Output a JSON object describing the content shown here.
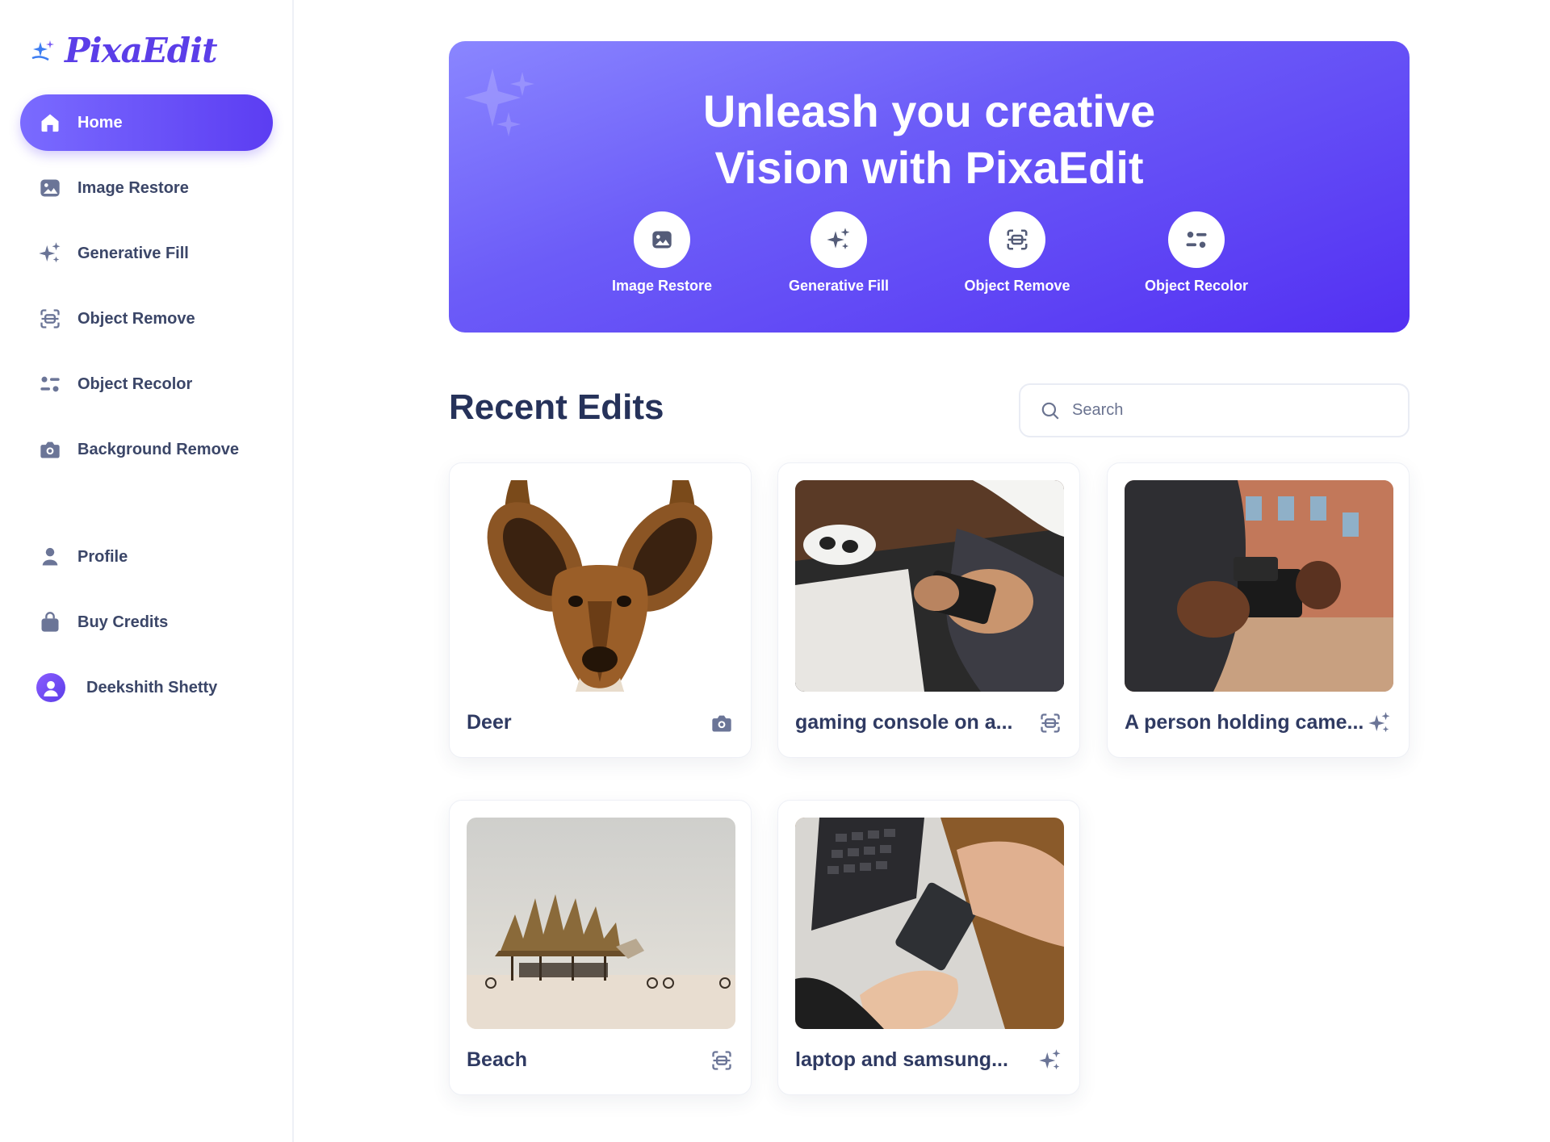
{
  "brand": {
    "name": "PixaEdit"
  },
  "sidebar": {
    "items": [
      {
        "label": "Home",
        "icon": "home-icon",
        "active": true
      },
      {
        "label": "Image Restore",
        "icon": "image-icon"
      },
      {
        "label": "Generative Fill",
        "icon": "sparkles-icon"
      },
      {
        "label": "Object Remove",
        "icon": "scan-icon"
      },
      {
        "label": "Object Recolor",
        "icon": "recolor-icon"
      },
      {
        "label": "Background Remove",
        "icon": "camera-icon"
      }
    ],
    "lower": [
      {
        "label": "Profile",
        "icon": "user-icon"
      },
      {
        "label": "Buy Credits",
        "icon": "bag-icon"
      }
    ],
    "user": {
      "name": "Deekshith Shetty"
    }
  },
  "hero": {
    "title_line1": "Unleash you creative",
    "title_line2": "Vision with PixaEdit",
    "actions": [
      {
        "label": "Image Restore",
        "icon": "image-icon"
      },
      {
        "label": "Generative Fill",
        "icon": "sparkles-icon"
      },
      {
        "label": "Object Remove",
        "icon": "scan-icon"
      },
      {
        "label": "Object Recolor",
        "icon": "recolor-icon"
      }
    ]
  },
  "recent": {
    "title": "Recent Edits",
    "search_placeholder": "Search",
    "cards": [
      {
        "title": "Deer",
        "icon": "camera-icon"
      },
      {
        "title": "gaming console on a...",
        "icon": "scan-icon"
      },
      {
        "title": "A person holding came...",
        "icon": "sparkles-icon"
      },
      {
        "title": "Beach",
        "icon": "scan-icon"
      },
      {
        "title": "laptop and samsung...",
        "icon": "sparkles-icon"
      }
    ]
  },
  "colors": {
    "accent": "#5c3df2",
    "text": "#2f3a62",
    "icon": "#6b7597"
  }
}
